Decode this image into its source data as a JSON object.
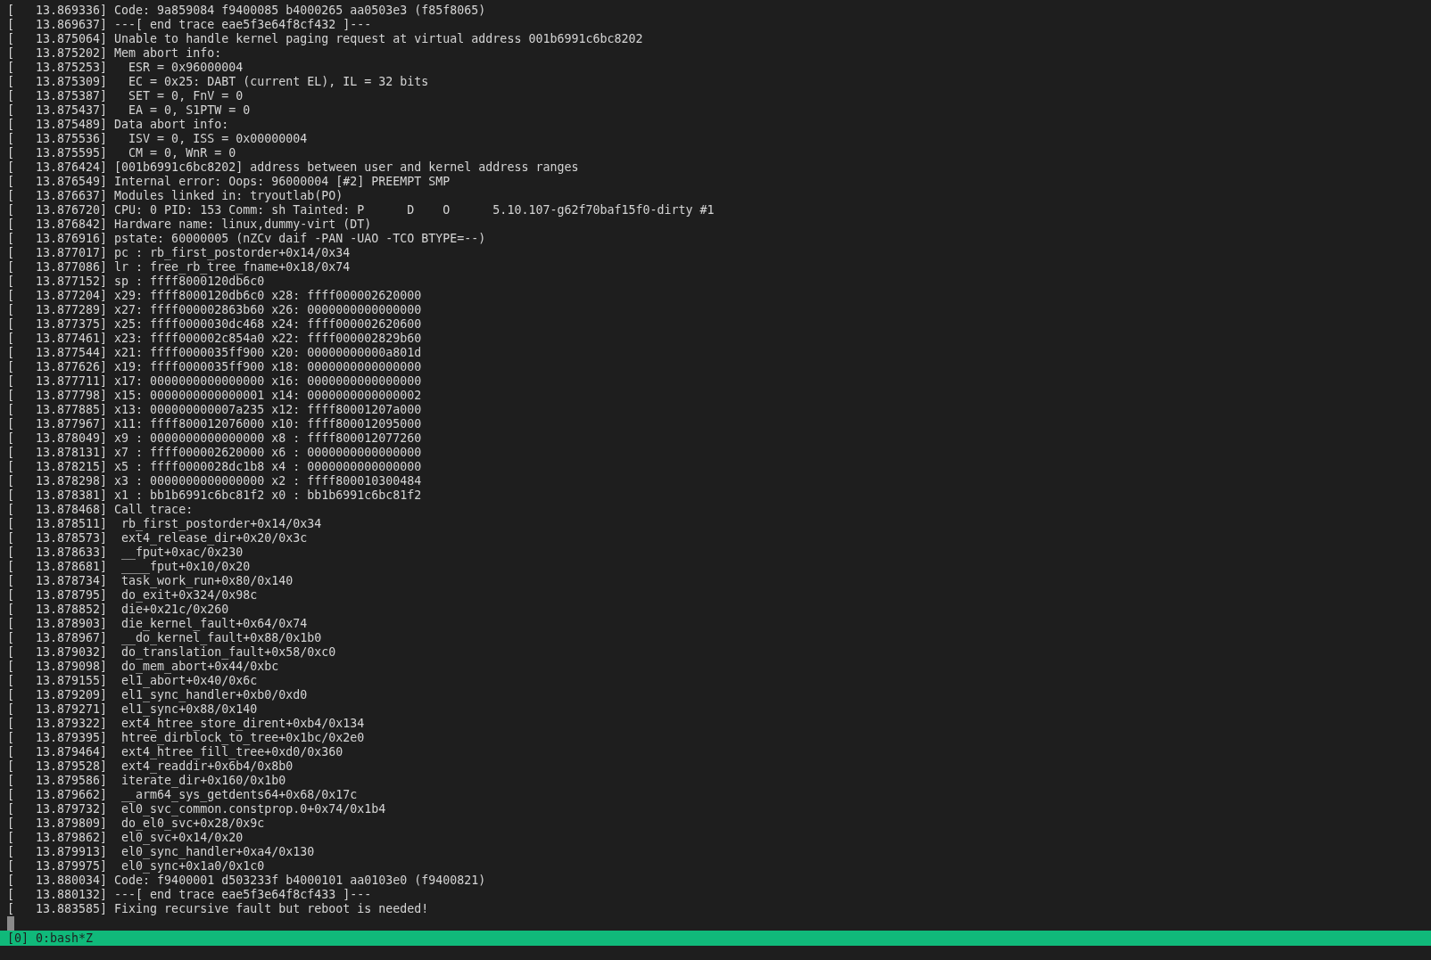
{
  "terminal": {
    "lines": [
      "[   13.869336] Code: 9a859084 f9400085 b4000265 aa0503e3 (f85f8065)",
      "[   13.869637] ---[ end trace eae5f3e64f8cf432 ]---",
      "[   13.875064] Unable to handle kernel paging request at virtual address 001b6991c6bc8202",
      "[   13.875202] Mem abort info:",
      "[   13.875253]   ESR = 0x96000004",
      "[   13.875309]   EC = 0x25: DABT (current EL), IL = 32 bits",
      "[   13.875387]   SET = 0, FnV = 0",
      "[   13.875437]   EA = 0, S1PTW = 0",
      "[   13.875489] Data abort info:",
      "[   13.875536]   ISV = 0, ISS = 0x00000004",
      "[   13.875595]   CM = 0, WnR = 0",
      "[   13.876424] [001b6991c6bc8202] address between user and kernel address ranges",
      "[   13.876549] Internal error: Oops: 96000004 [#2] PREEMPT SMP",
      "[   13.876637] Modules linked in: tryoutlab(PO)",
      "[   13.876720] CPU: 0 PID: 153 Comm: sh Tainted: P      D    O      5.10.107-g62f70baf15f0-dirty #1",
      "[   13.876842] Hardware name: linux,dummy-virt (DT)",
      "[   13.876916] pstate: 60000005 (nZCv daif -PAN -UAO -TCO BTYPE=--)",
      "[   13.877017] pc : rb_first_postorder+0x14/0x34",
      "[   13.877086] lr : free_rb_tree_fname+0x18/0x74",
      "[   13.877152] sp : ffff8000120db6c0",
      "[   13.877204] x29: ffff8000120db6c0 x28: ffff000002620000",
      "[   13.877289] x27: ffff000002863b60 x26: 0000000000000000",
      "[   13.877375] x25: ffff0000030dc468 x24: ffff000002620600",
      "[   13.877461] x23: ffff000002c854a0 x22: ffff000002829b60",
      "[   13.877544] x21: ffff0000035ff900 x20: 00000000000a801d",
      "[   13.877626] x19: ffff0000035ff900 x18: 0000000000000000",
      "[   13.877711] x17: 0000000000000000 x16: 0000000000000000",
      "[   13.877798] x15: 0000000000000001 x14: 0000000000000002",
      "[   13.877885] x13: 000000000007a235 x12: ffff80001207a000",
      "[   13.877967] x11: ffff800012076000 x10: ffff800012095000",
      "[   13.878049] x9 : 0000000000000000 x8 : ffff800012077260",
      "[   13.878131] x7 : ffff000002620000 x6 : 0000000000000000",
      "[   13.878215] x5 : ffff0000028dc1b8 x4 : 0000000000000000",
      "[   13.878298] x3 : 0000000000000000 x2 : ffff800010300484",
      "[   13.878381] x1 : bb1b6991c6bc81f2 x0 : bb1b6991c6bc81f2",
      "[   13.878468] Call trace:",
      "[   13.878511]  rb_first_postorder+0x14/0x34",
      "[   13.878573]  ext4_release_dir+0x20/0x3c",
      "[   13.878633]  __fput+0xac/0x230",
      "[   13.878681]  ____fput+0x10/0x20",
      "[   13.878734]  task_work_run+0x80/0x140",
      "[   13.878795]  do_exit+0x324/0x98c",
      "[   13.878852]  die+0x21c/0x260",
      "[   13.878903]  die_kernel_fault+0x64/0x74",
      "[   13.878967]  __do_kernel_fault+0x88/0x1b0",
      "[   13.879032]  do_translation_fault+0x58/0xc0",
      "[   13.879098]  do_mem_abort+0x44/0xbc",
      "[   13.879155]  el1_abort+0x40/0x6c",
      "[   13.879209]  el1_sync_handler+0xb0/0xd0",
      "[   13.879271]  el1_sync+0x88/0x140",
      "[   13.879322]  ext4_htree_store_dirent+0xb4/0x134",
      "[   13.879395]  htree_dirblock_to_tree+0x1bc/0x2e0",
      "[   13.879464]  ext4_htree_fill_tree+0xd0/0x360",
      "[   13.879528]  ext4_readdir+0x6b4/0x8b0",
      "[   13.879586]  iterate_dir+0x160/0x1b0",
      "[   13.879662]  __arm64_sys_getdents64+0x68/0x17c",
      "[   13.879732]  el0_svc_common.constprop.0+0x74/0x1b4",
      "[   13.879809]  do_el0_svc+0x28/0x9c",
      "[   13.879862]  el0_svc+0x14/0x20",
      "[   13.879913]  el0_sync_handler+0xa4/0x130",
      "[   13.879975]  el0_sync+0x1a0/0x1c0",
      "[   13.880034] Code: f9400001 d503233f b4000101 aa0103e0 (f9400821)",
      "[   13.880132] ---[ end trace eae5f3e64f8cf433 ]---",
      "[   13.883585] Fixing recursive fault but reboot is needed!"
    ]
  },
  "status_bar": {
    "text": "[0] 0:bash*Z"
  }
}
